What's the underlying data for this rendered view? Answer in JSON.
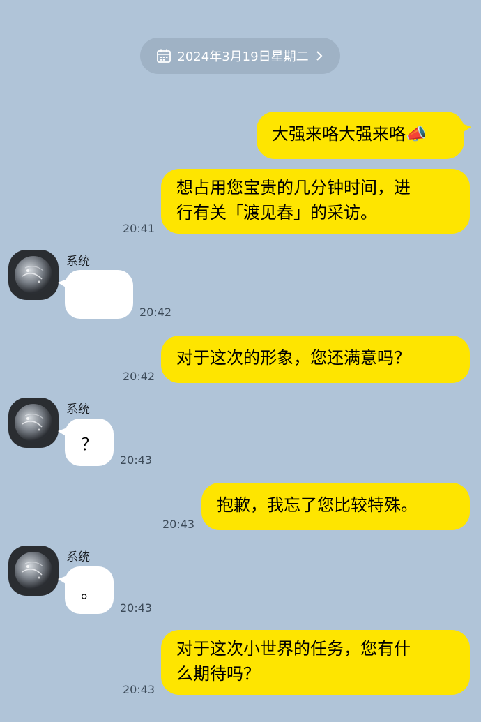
{
  "date_chip": {
    "label": "2024年3月19日星期二",
    "icon": "calendar-icon",
    "chevron": "chevron-right-icon"
  },
  "messages": [
    {
      "from": "me",
      "text": "大强来咯大强来咯📣",
      "time": ""
    },
    {
      "from": "me",
      "lines": [
        "想占用您宝贵的几分钟时间，进",
        "行有关「渡见春」的采访。"
      ],
      "time": "20:41"
    },
    {
      "from": "system",
      "sender": "系统",
      "text": "",
      "time": "20:42"
    },
    {
      "from": "me",
      "text": "对于这次的形象，您还满意吗？",
      "time": "20:42"
    },
    {
      "from": "system",
      "sender": "系统",
      "text": "？",
      "time": "20:43"
    },
    {
      "from": "me",
      "text": "抱歉，我忘了您比较特殊。",
      "time": "20:43"
    },
    {
      "from": "system",
      "sender": "系统",
      "text": "。",
      "time": "20:43"
    },
    {
      "from": "me",
      "lines": [
        "对于这次小世界的任务，您有什",
        "么期待吗？"
      ],
      "time": "20:43"
    }
  ],
  "colors": {
    "background": "#b0c4d8",
    "outgoing_bubble": "#fee500",
    "incoming_bubble": "#ffffff"
  }
}
